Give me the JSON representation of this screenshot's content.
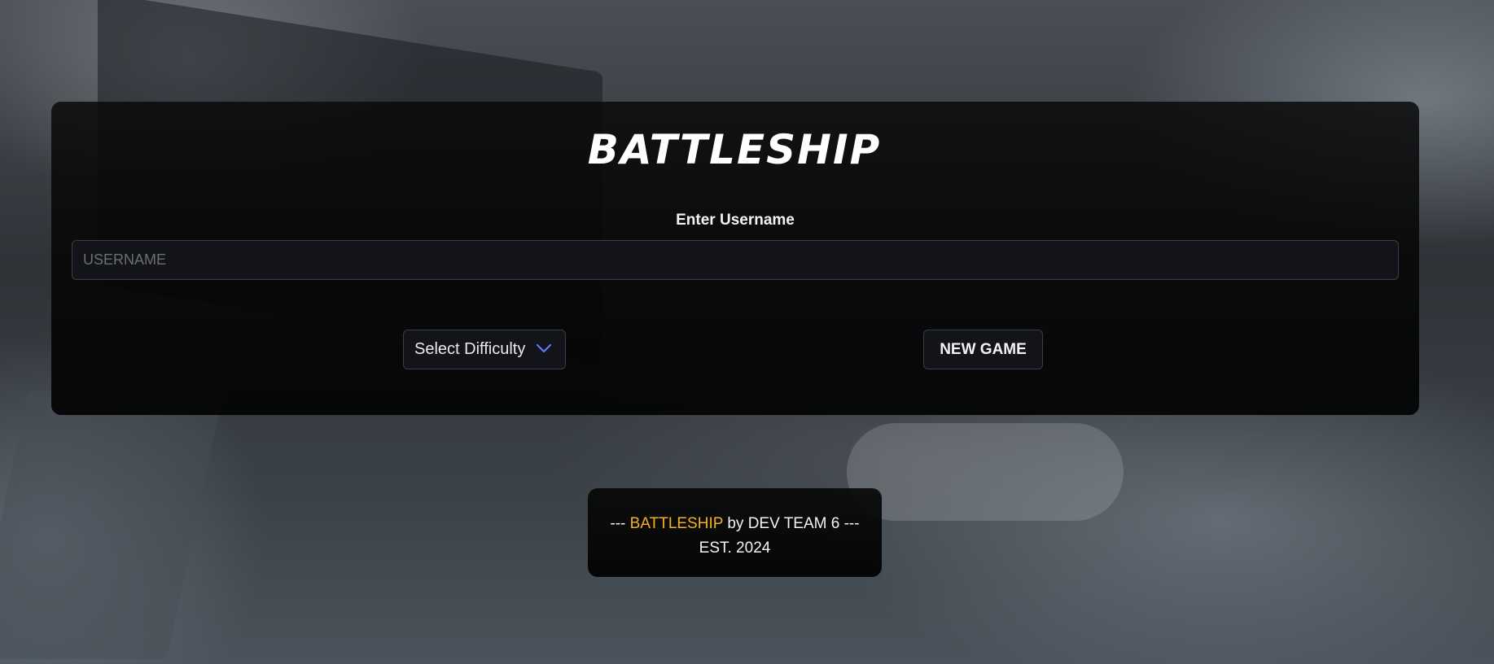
{
  "app": {
    "title": "BATTLESHIP"
  },
  "form": {
    "username_label": "Enter Username",
    "username_placeholder": "USERNAME",
    "username_value": "",
    "difficulty_label": "Select Difficulty",
    "difficulty_icon": "chevron-down-icon",
    "new_game_label": "NEW GAME"
  },
  "footer": {
    "prefix": "---",
    "brand": "BATTLESHIP",
    "by_text": "by DEV TEAM 6 ---",
    "established": "EST. 2024"
  },
  "colors": {
    "brand_accent": "#f5b21c",
    "chevron": "#5b7cff",
    "panel_background": "#050505"
  }
}
